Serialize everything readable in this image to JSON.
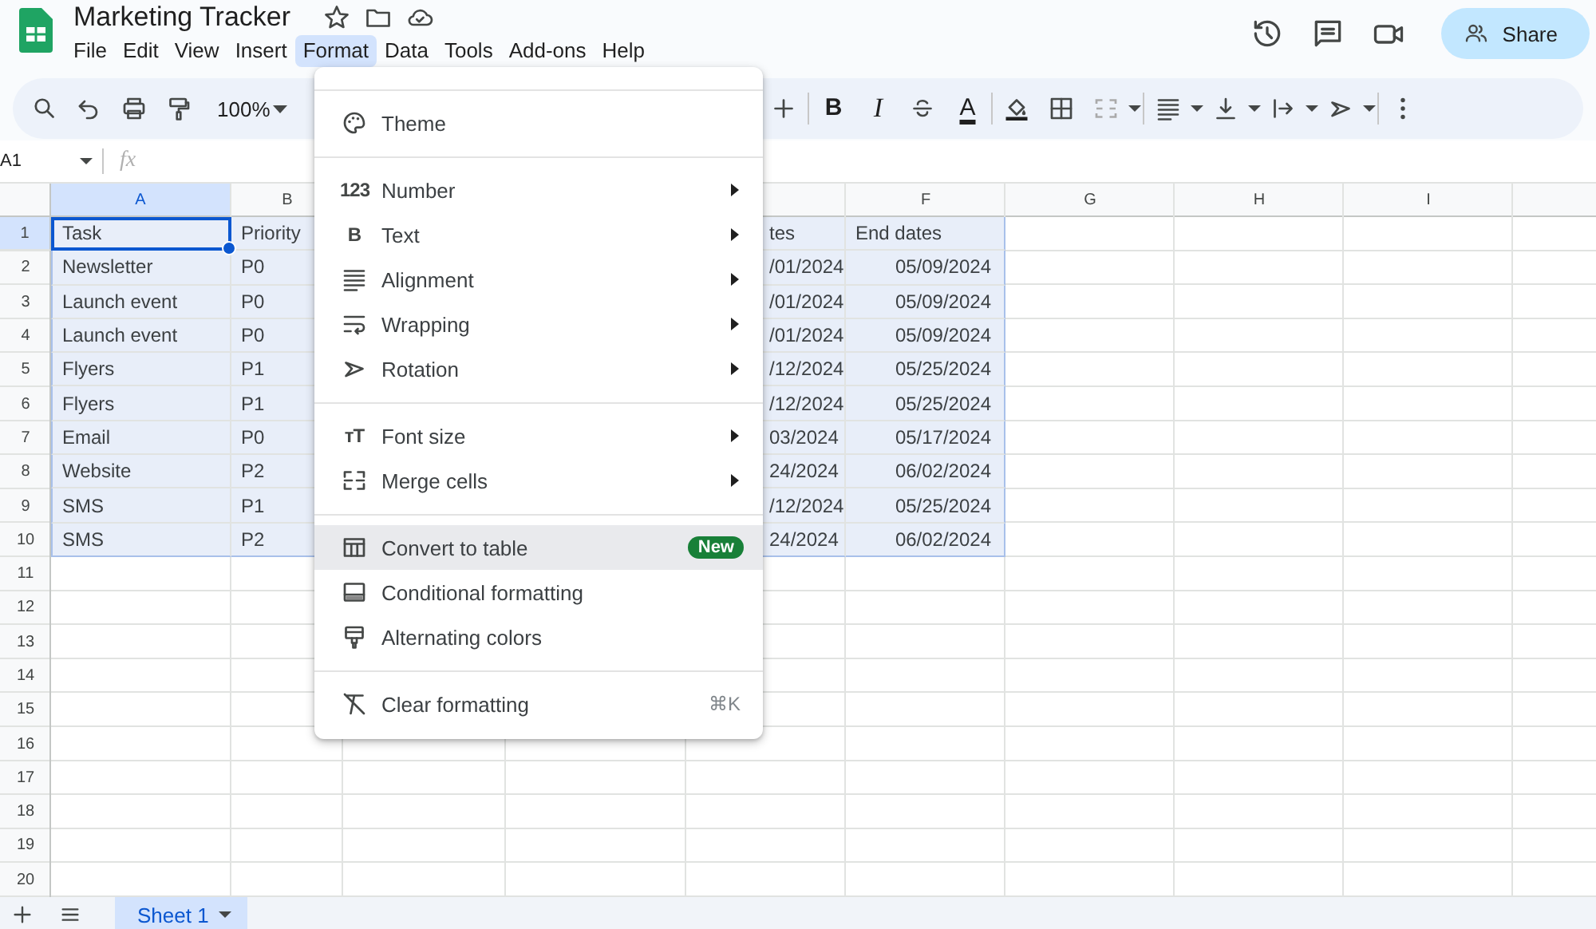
{
  "document": {
    "title": "Marketing Tracker"
  },
  "menubar": [
    {
      "label": "File",
      "selected": false
    },
    {
      "label": "Edit",
      "selected": false
    },
    {
      "label": "View",
      "selected": false
    },
    {
      "label": "Insert",
      "selected": false
    },
    {
      "label": "Format",
      "selected": true
    },
    {
      "label": "Data",
      "selected": false
    },
    {
      "label": "Tools",
      "selected": false
    },
    {
      "label": "Add-ons",
      "selected": false
    },
    {
      "label": "Help",
      "selected": false
    }
  ],
  "share_button": {
    "label": "Share"
  },
  "toolbar": {
    "zoom": "100%",
    "bold": "B",
    "italic": "I",
    "text_color": "A"
  },
  "formula_bar": {
    "cell_reference": "A1",
    "function_label": "fx"
  },
  "columns": [
    {
      "label": "A",
      "selected": true
    },
    {
      "label": "B",
      "selected": false
    },
    {
      "label": "F",
      "selected": false
    },
    {
      "label": "G",
      "selected": false
    },
    {
      "label": "H",
      "selected": false
    },
    {
      "label": "I",
      "selected": false
    }
  ],
  "rows": [
    {
      "number": "1",
      "selected": true,
      "cells": [
        "Task",
        "Priority",
        "tes",
        "End dates"
      ]
    },
    {
      "number": "2",
      "selected": false,
      "cells": [
        "Newsletter",
        "P0",
        "/01/2024",
        "05/09/2024"
      ]
    },
    {
      "number": "3",
      "selected": false,
      "cells": [
        "Launch event",
        "P0",
        "/01/2024",
        "05/09/2024"
      ]
    },
    {
      "number": "4",
      "selected": false,
      "cells": [
        "Launch event",
        "P0",
        "/01/2024",
        "05/09/2024"
      ]
    },
    {
      "number": "5",
      "selected": false,
      "cells": [
        "Flyers",
        "P1",
        "/12/2024",
        "05/25/2024"
      ]
    },
    {
      "number": "6",
      "selected": false,
      "cells": [
        "Flyers",
        "P1",
        "/12/2024",
        "05/25/2024"
      ]
    },
    {
      "number": "7",
      "selected": false,
      "cells": [
        "Email",
        "P0",
        "03/2024",
        "05/17/2024"
      ]
    },
    {
      "number": "8",
      "selected": false,
      "cells": [
        "Website",
        "P2",
        "24/2024",
        "06/02/2024"
      ]
    },
    {
      "number": "9",
      "selected": false,
      "cells": [
        "SMS",
        "P1",
        "/12/2024",
        "05/25/2024"
      ]
    },
    {
      "number": "10",
      "selected": false,
      "cells": [
        "SMS",
        "P2",
        "24/2024",
        "06/02/2024"
      ]
    },
    {
      "number": "11",
      "selected": false
    },
    {
      "number": "12",
      "selected": false
    },
    {
      "number": "13",
      "selected": false
    },
    {
      "number": "14",
      "selected": false
    },
    {
      "number": "15",
      "selected": false
    },
    {
      "number": "16",
      "selected": false
    },
    {
      "number": "17",
      "selected": false
    },
    {
      "number": "18",
      "selected": false
    },
    {
      "number": "19",
      "selected": false
    },
    {
      "number": "20",
      "selected": false
    }
  ],
  "format_menu": {
    "sections": [
      {
        "items": [
          {
            "label": "Theme",
            "submenu": false,
            "highlighted": false
          }
        ]
      },
      {
        "items": [
          {
            "label": "Number",
            "glyph": "123",
            "submenu": true,
            "highlighted": false
          },
          {
            "label": "Text",
            "glyph": "B",
            "submenu": true,
            "highlighted": false
          },
          {
            "label": "Alignment",
            "submenu": true,
            "highlighted": false
          },
          {
            "label": "Wrapping",
            "submenu": true,
            "highlighted": false
          },
          {
            "label": "Rotation",
            "submenu": true,
            "highlighted": false
          }
        ]
      },
      {
        "items": [
          {
            "label": "Font size",
            "glyph": "тT",
            "submenu": true,
            "highlighted": false
          },
          {
            "label": "Merge cells",
            "submenu": true,
            "highlighted": false
          }
        ]
      },
      {
        "items": [
          {
            "label": "Convert to table",
            "badge": "New",
            "submenu": false,
            "highlighted": true
          },
          {
            "label": "Conditional formatting",
            "submenu": false,
            "highlighted": false
          },
          {
            "label": "Alternating colors",
            "submenu": false,
            "highlighted": false
          }
        ]
      },
      {
        "items": [
          {
            "label": "Clear formatting",
            "shortcut": "⌘K",
            "submenu": false,
            "highlighted": false
          }
        ]
      }
    ]
  },
  "sheet_tabs": [
    {
      "label": "Sheet 1",
      "selected": true
    }
  ]
}
